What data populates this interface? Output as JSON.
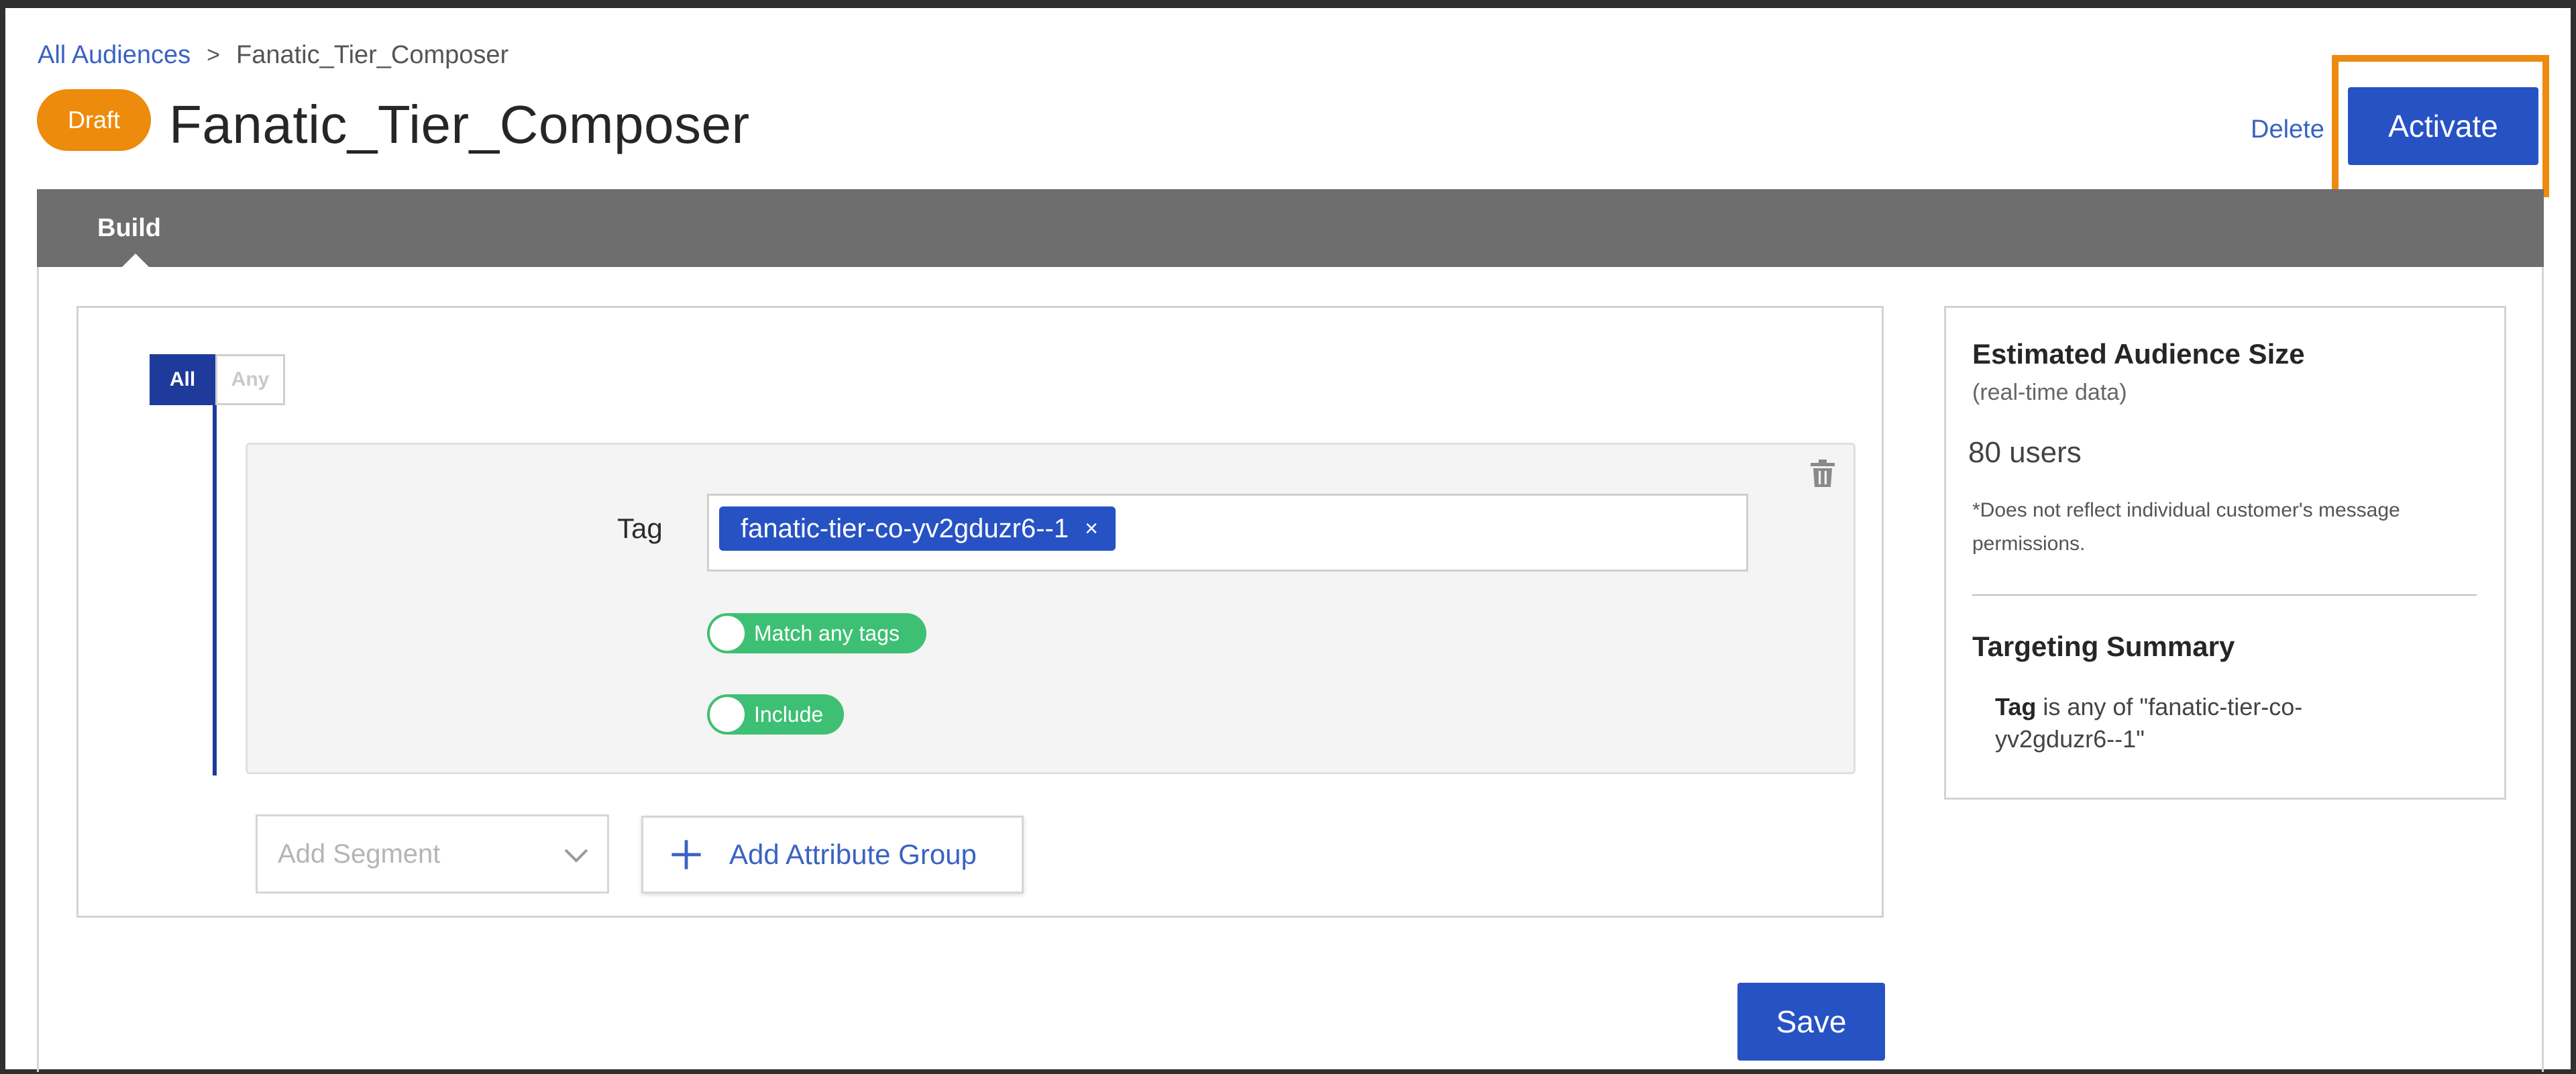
{
  "breadcrumb": {
    "parent": "All Audiences",
    "separator": ">",
    "current": "Fanatic_Tier_Composer"
  },
  "header": {
    "status_badge": "Draft",
    "title": "Fanatic_Tier_Composer",
    "delete_label": "Delete",
    "activate_label": "Activate"
  },
  "tabs": [
    {
      "label": "Build",
      "active": true
    }
  ],
  "builder": {
    "logic_all": "All",
    "logic_any": "Any",
    "condition": {
      "field_label": "Tag",
      "tags": [
        {
          "value": "fanatic-tier-co-yv2gduzr6--1",
          "remove": "×"
        }
      ],
      "toggle_match": "Match any tags",
      "toggle_include": "Include"
    },
    "add_segment_placeholder": "Add Segment",
    "add_attribute_group": "Add Attribute Group",
    "save_label": "Save"
  },
  "summary": {
    "title": "Estimated Audience Size",
    "subtitle": "(real-time data)",
    "count": "80 users",
    "note": "*Does not reflect individual customer's message permissions.",
    "targeting_title": "Targeting Summary",
    "targeting_field": "Tag",
    "targeting_text": " is any of \"fanatic-tier-co-yv2gduzr6--1\""
  },
  "colors": {
    "accent_blue": "#2752c4",
    "logic_navy": "#1e3b9b",
    "draft_orange": "#ed8b0c",
    "highlight_orange": "#ef8a10",
    "toggle_green": "#3ec074",
    "tabbar_gray": "#6e6e6e"
  },
  "icons": [
    "chevron-right-icon",
    "trash-icon",
    "close-icon",
    "chevron-down-icon",
    "plus-icon"
  ]
}
